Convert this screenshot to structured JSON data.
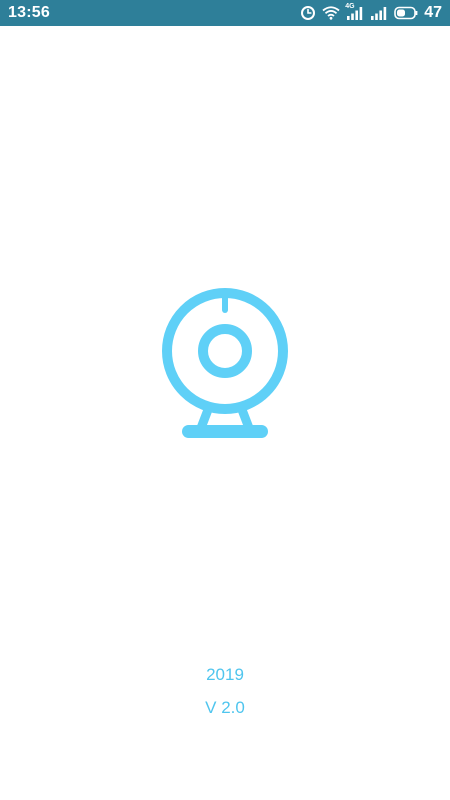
{
  "status_bar": {
    "time": "13:56",
    "network_tag": "4G",
    "battery_percent": "47",
    "icons": [
      "alarm-icon",
      "wifi-icon",
      "signal-4g-icon",
      "signal-icon",
      "battery-icon"
    ],
    "background_color": "#2e7f99"
  },
  "splash": {
    "logo_icon": "webcam-icon",
    "logo_color": "#5fd0f7",
    "year": "2019",
    "version": "V 2.0",
    "text_color": "#4fc5ee"
  }
}
